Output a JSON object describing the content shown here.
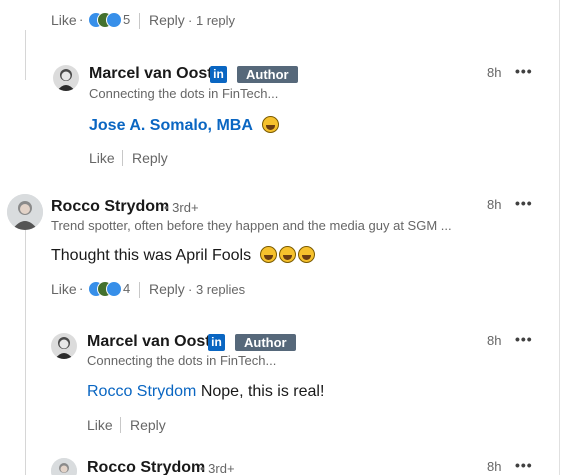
{
  "top_actions": {
    "like": "Like",
    "dot": "·",
    "reaction_count": "5",
    "reply": "Reply",
    "reply_count": "· 1 reply"
  },
  "reply1": {
    "name": "Marcel van Oost",
    "linkedin_logo": "in",
    "badge": "Author",
    "headline": "Connecting the dots in FinTech...",
    "time": "8h",
    "more": "•••",
    "mention": "Jose A. Somalo, MBA",
    "emoji": "rolling-on-floor-laughing",
    "like": "Like",
    "reply": "Reply"
  },
  "comment2": {
    "name": "Rocco Strydom",
    "degree": "• 3rd+",
    "headline": "Trend spotter, often before they happen and the media guy at SGM ...",
    "time": "8h",
    "more": "•••",
    "text": "Thought this was April Fools",
    "emojis": [
      "rolling-on-floor-laughing",
      "rolling-on-floor-laughing",
      "rolling-on-floor-laughing"
    ],
    "like": "Like",
    "dot": "·",
    "reaction_count": "4",
    "reply": "Reply",
    "reply_count": "· 3 replies"
  },
  "reply2": {
    "name": "Marcel van Oost",
    "linkedin_logo": "in",
    "badge": "Author",
    "headline": "Connecting the dots in FinTech...",
    "time": "8h",
    "more": "•••",
    "mention": "Rocco Strydom",
    "text": " Nope, this is real!",
    "like": "Like",
    "reply": "Reply"
  },
  "reply3": {
    "name": "Rocco Strydom",
    "degree": "• 3rd+",
    "time": "8h",
    "more": "•••"
  },
  "colors": {
    "link": "#0a66c2",
    "badge": "#56687a",
    "muted": "#666666",
    "like_blue": "#378fe9",
    "clap_green": "#44712e"
  }
}
